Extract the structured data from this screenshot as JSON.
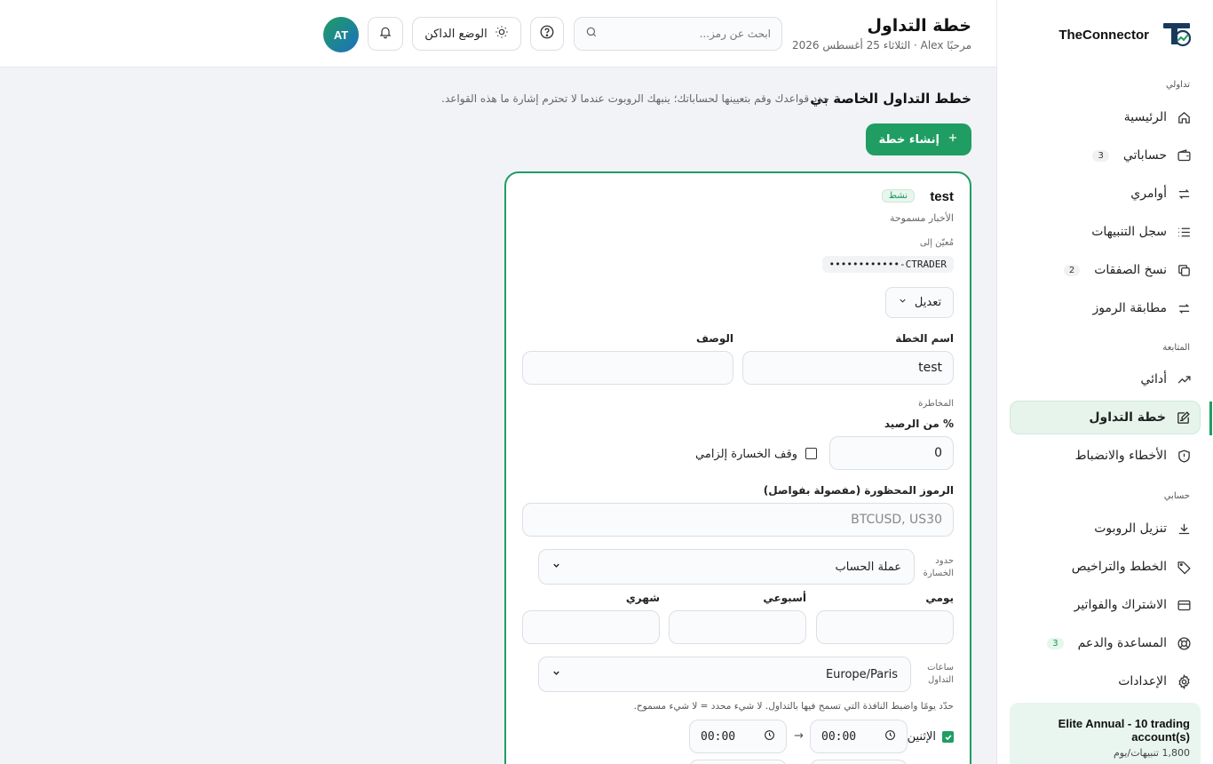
{
  "brand": {
    "name": "TheConnector"
  },
  "header": {
    "title": "خطة التداول",
    "subtitle": "مرحبًا Alex · الثلاثاء 25 أغسطس 2026",
    "search_placeholder": "ابحث عن رمز...",
    "theme_label": "الوضع الداكن",
    "avatar_initials": "AT"
  },
  "sidebar": {
    "section_trading": "تداولي",
    "section_tracking": "المتابعة",
    "section_account": "حسابي",
    "items": [
      {
        "label": "الرئيسية",
        "icon": "home-icon"
      },
      {
        "label": "حساباتي",
        "icon": "wallet-icon",
        "badge": "3"
      },
      {
        "label": "أوامري",
        "icon": "swap-icon"
      },
      {
        "label": "سجل التنبيهات",
        "icon": "list-icon"
      },
      {
        "label": "نسخ الصفقات",
        "icon": "copy-icon",
        "badge": "2"
      },
      {
        "label": "مطابقة الرموز",
        "icon": "swap-icon"
      },
      {
        "label": "أدائي",
        "icon": "trending-up-icon"
      },
      {
        "label": "خطة التداول",
        "icon": "edit-note-icon",
        "active": true
      },
      {
        "label": "الأخطاء والانضباط",
        "icon": "shield-icon"
      },
      {
        "label": "تنزيل الروبوت",
        "icon": "download-icon"
      },
      {
        "label": "الخطط والتراخيص",
        "icon": "tag-icon"
      },
      {
        "label": "الاشتراك والفواتير",
        "icon": "credit-card-icon"
      },
      {
        "label": "المساعدة والدعم",
        "icon": "lifebuoy-icon",
        "badge": "3"
      },
      {
        "label": "الإعدادات",
        "icon": "gear-icon"
      }
    ],
    "plan_card": {
      "title": "Elite Annual - 10 trading account(s)",
      "subtitle": "1,800 تنبيهات/يوم"
    }
  },
  "main": {
    "section_title": "خطط التداول الخاصة بي",
    "section_desc": "حدد قواعدك وقم بتعيينها لحساباتك؛ ينبهك الروبوت عندما لا تحترم إشارة ما هذه القواعد.",
    "create_button": "إنشاء خطة",
    "plan": {
      "name": "test",
      "status": "نشط",
      "news": "الأخبار مسموحة",
      "assigned_label": "مُعيّن إلى",
      "account": "••••••••••••-CTRADER",
      "edit_label": "تعديل",
      "name_label": "اسم الخطة",
      "name_value": "test",
      "desc_label": "الوصف",
      "desc_value": "",
      "risk_label": "المخاطرة",
      "balance_pct_label": "% من الرصيد",
      "balance_pct_value": "0",
      "mandatory_sl_label": "وقف الخسارة إلزامي",
      "mandatory_sl_checked": false,
      "forbidden_label": "الرموز المحظورة (مفصولة بفواصل)",
      "forbidden_placeholder": "BTCUSD, US30",
      "loss_limits_label": "حدود الخسارة",
      "loss_currency": "عملة الحساب",
      "daily_label": "يومي",
      "weekly_label": "أسبوعي",
      "monthly_label": "شهري",
      "trading_hours_label": "ساعات التداول",
      "timezone": "Europe/Paris",
      "hours_hint": "حدّد يومًا واضبط النافذة التي تسمح فيها بالتداول. لا شيء محدد = لا شيء مسموح.",
      "days": [
        {
          "label": "الإثنين",
          "checked": true,
          "start": "00:00",
          "end": "00:00"
        }
      ]
    }
  },
  "colors": {
    "accent": "#1f9d63",
    "background": "#f1f3f6"
  }
}
